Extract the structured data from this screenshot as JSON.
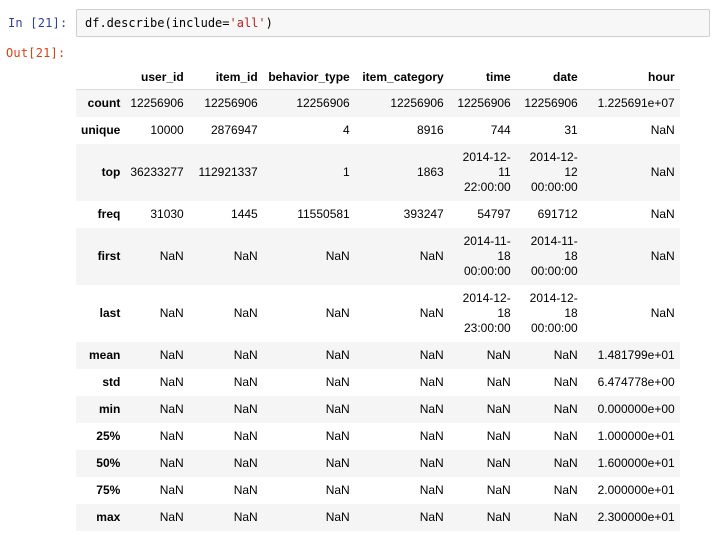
{
  "prompts": {
    "in": "In  [21]:",
    "out": "Out[21]:"
  },
  "code": {
    "prefix": "df.describe(include=",
    "string": "'all'",
    "suffix": ")"
  },
  "table": {
    "columns": [
      "",
      "user_id",
      "item_id",
      "behavior_type",
      "item_category",
      "time",
      "date",
      "hour"
    ],
    "rows": [
      {
        "index": "count",
        "cells": [
          "12256906",
          "12256906",
          "12256906",
          "12256906",
          "12256906",
          "12256906",
          "1.225691e+07"
        ]
      },
      {
        "index": "unique",
        "cells": [
          "10000",
          "2876947",
          "4",
          "8916",
          "744",
          "31",
          "NaN"
        ]
      },
      {
        "index": "top",
        "cells": [
          "36233277",
          "112921337",
          "1",
          "1863",
          "2014-12-\n11\n22:00:00",
          "2014-12-\n12\n00:00:00",
          "NaN"
        ]
      },
      {
        "index": "freq",
        "cells": [
          "31030",
          "1445",
          "11550581",
          "393247",
          "54797",
          "691712",
          "NaN"
        ]
      },
      {
        "index": "first",
        "cells": [
          "NaN",
          "NaN",
          "NaN",
          "NaN",
          "2014-11-\n18\n00:00:00",
          "2014-11-\n18\n00:00:00",
          "NaN"
        ]
      },
      {
        "index": "last",
        "cells": [
          "NaN",
          "NaN",
          "NaN",
          "NaN",
          "2014-12-\n18\n23:00:00",
          "2014-12-\n18\n00:00:00",
          "NaN"
        ]
      },
      {
        "index": "mean",
        "cells": [
          "NaN",
          "NaN",
          "NaN",
          "NaN",
          "NaN",
          "NaN",
          "1.481799e+01"
        ]
      },
      {
        "index": "std",
        "cells": [
          "NaN",
          "NaN",
          "NaN",
          "NaN",
          "NaN",
          "NaN",
          "6.474778e+00"
        ]
      },
      {
        "index": "min",
        "cells": [
          "NaN",
          "NaN",
          "NaN",
          "NaN",
          "NaN",
          "NaN",
          "0.000000e+00"
        ]
      },
      {
        "index": "25%",
        "cells": [
          "NaN",
          "NaN",
          "NaN",
          "NaN",
          "NaN",
          "NaN",
          "1.000000e+01"
        ]
      },
      {
        "index": "50%",
        "cells": [
          "NaN",
          "NaN",
          "NaN",
          "NaN",
          "NaN",
          "NaN",
          "1.600000e+01"
        ]
      },
      {
        "index": "75%",
        "cells": [
          "NaN",
          "NaN",
          "NaN",
          "NaN",
          "NaN",
          "NaN",
          "2.000000e+01"
        ]
      },
      {
        "index": "max",
        "cells": [
          "NaN",
          "NaN",
          "NaN",
          "NaN",
          "NaN",
          "NaN",
          "2.300000e+01"
        ]
      }
    ]
  },
  "colors": {
    "in_prompt": "#303f9f",
    "out_prompt": "#d84315",
    "string": "#ba2121",
    "stripe": "#f5f5f5"
  }
}
